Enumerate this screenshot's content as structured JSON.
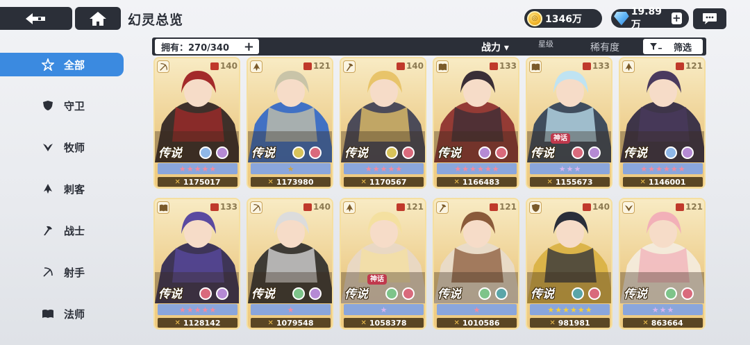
{
  "header": {
    "title": "幻灵总览",
    "gold": "1346万",
    "gems": "19.89万",
    "plus": "+"
  },
  "sidebar": {
    "items": [
      {
        "label": "全部",
        "icon": "star-outline-icon",
        "active": true
      },
      {
        "label": "守卫",
        "icon": "shield-icon"
      },
      {
        "label": "牧师",
        "icon": "wings-icon"
      },
      {
        "label": "刺客",
        "icon": "dagger-icon"
      },
      {
        "label": "战士",
        "icon": "axe-icon"
      },
      {
        "label": "射手",
        "icon": "bow-icon"
      },
      {
        "label": "法师",
        "icon": "book-icon"
      }
    ]
  },
  "filter": {
    "owned_label": "拥有：270/340",
    "owned_plus": "+",
    "sort_power": "战力 ▾",
    "sort_star": "星级",
    "sort_rarity": "稀有度",
    "filter_label": "筛选"
  },
  "cards": [
    {
      "level": "140",
      "rarity": "传说",
      "power": "1175017",
      "class_icon": "bow-icon",
      "stars": 5,
      "star_color": "#f28aa0",
      "elements": [
        "#8fb7e8",
        "#b58ad4"
      ],
      "art": [
        "#a32a2a",
        "#2a1e1e"
      ],
      "myth": ""
    },
    {
      "level": "121",
      "rarity": "传说",
      "power": "1173980",
      "class_icon": "dagger-icon",
      "stars": 1,
      "star_color": "#c9a34a",
      "elements": [
        "#d8c35a",
        "#d96a7c"
      ],
      "art": [
        "#c9c4a8",
        "#2d66c9"
      ],
      "myth": ""
    },
    {
      "level": "140",
      "rarity": "传说",
      "power": "1170567",
      "class_icon": "axe-icon",
      "stars": 5,
      "star_color": "#f28aa0",
      "elements": [
        "#d8c35a",
        "#d96a7c"
      ],
      "art": [
        "#e8c46a",
        "#3a3c52"
      ],
      "myth": ""
    },
    {
      "level": "133",
      "rarity": "传说",
      "power": "1166483",
      "class_icon": "book-icon",
      "stars": 6,
      "star_color": "#f28aa0",
      "elements": [
        "#b58ad4",
        "#d96a7c"
      ],
      "art": [
        "#3a2e36",
        "#8a2a2a"
      ],
      "myth": ""
    },
    {
      "level": "133",
      "rarity": "传说",
      "power": "1155673",
      "class_icon": "book-icon",
      "stars": 3,
      "star_color": "#d8b5f0",
      "elements": [
        "#d96a7c",
        "#b58ad4"
      ],
      "art": [
        "#bfe3f2",
        "#2c3e56"
      ],
      "myth": "神话"
    },
    {
      "level": "121",
      "rarity": "传说",
      "power": "1146001",
      "class_icon": "dagger-icon",
      "stars": 6,
      "star_color": "#f28aa0",
      "elements": [
        "#8fb7e8",
        "#b58ad4"
      ],
      "art": [
        "#4a3a5e",
        "#2a2440"
      ],
      "myth": ""
    },
    {
      "level": "133",
      "rarity": "传说",
      "power": "1128142",
      "class_icon": "book-icon",
      "stars": 5,
      "star_color": "#f28aa0",
      "elements": [
        "#d96a7c",
        "#b58ad4"
      ],
      "art": [
        "#5a4aa0",
        "#2a2450"
      ],
      "myth": ""
    },
    {
      "level": "140",
      "rarity": "传说",
      "power": "1079548",
      "class_icon": "bow-icon",
      "stars": 1,
      "star_color": "#f28aa0",
      "elements": [
        "#7ec48a",
        "#b58ad4"
      ],
      "art": [
        "#dcdcdc",
        "#2a2a2a"
      ],
      "myth": ""
    },
    {
      "level": "121",
      "rarity": "传说",
      "power": "1058378",
      "class_icon": "dagger-icon",
      "stars": 1,
      "star_color": "#d8b5f0",
      "elements": [
        "#7ec48a",
        "#d96a7c"
      ],
      "art": [
        "#f4e0a0",
        "#e8d8c8"
      ],
      "myth": "神话"
    },
    {
      "level": "121",
      "rarity": "传说",
      "power": "1010586",
      "class_icon": "axe-icon",
      "stars": 1,
      "star_color": "#f28aa0",
      "elements": [
        "#7ec48a",
        "#5aa5a8"
      ],
      "art": [
        "#8a5a3a",
        "#e8dccc"
      ],
      "myth": ""
    },
    {
      "level": "140",
      "rarity": "传说",
      "power": "981981",
      "class_icon": "shield-icon",
      "stars": 6,
      "star_color": "#f5d03a",
      "elements": [
        "#5aa5a8",
        "#d96a7c"
      ],
      "art": [
        "#2a2e3a",
        "#d8b040"
      ],
      "myth": ""
    },
    {
      "level": "121",
      "rarity": "传说",
      "power": "863664",
      "class_icon": "wings-icon",
      "stars": 3,
      "star_color": "#d8b5f0",
      "elements": [
        "#7ec48a",
        "#d96a7c"
      ],
      "art": [
        "#f2b0b8",
        "#f4ece0"
      ],
      "myth": ""
    }
  ]
}
